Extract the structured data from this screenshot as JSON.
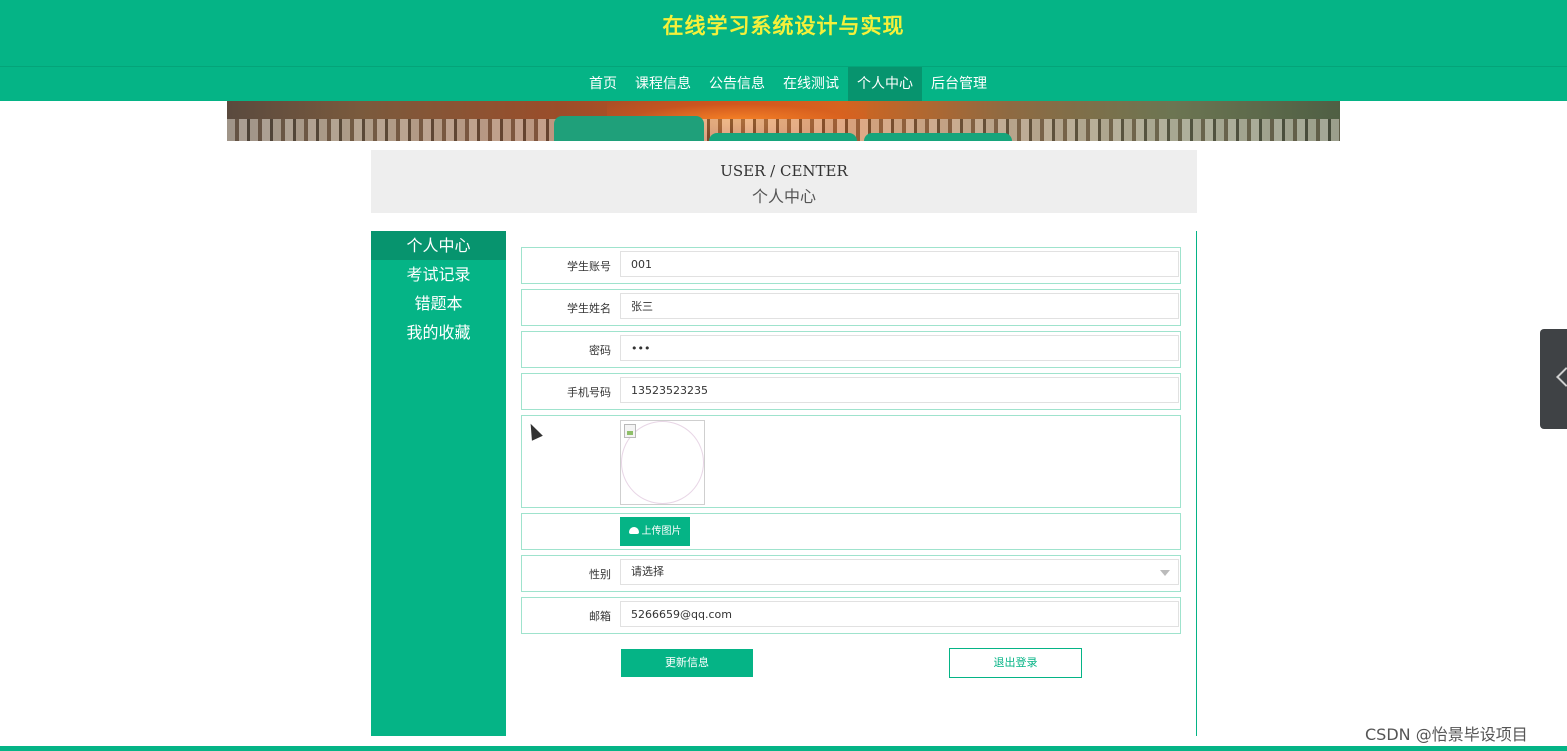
{
  "site": {
    "title": "在线学习系统设计与实现"
  },
  "nav": {
    "items": [
      {
        "label": "首页"
      },
      {
        "label": "课程信息"
      },
      {
        "label": "公告信息"
      },
      {
        "label": "在线测试"
      },
      {
        "label": "个人中心",
        "active": true
      },
      {
        "label": "后台管理"
      }
    ]
  },
  "section": {
    "title_en": "USER / CENTER",
    "title_cn": "个人中心"
  },
  "sidebar": {
    "items": [
      {
        "label": "个人中心",
        "active": true
      },
      {
        "label": "考试记录"
      },
      {
        "label": "错题本"
      },
      {
        "label": "我的收藏"
      }
    ]
  },
  "form": {
    "account": {
      "label": "学生账号",
      "value": "001"
    },
    "name": {
      "label": "学生姓名",
      "value": "张三"
    },
    "password": {
      "label": "密码",
      "value": "•••"
    },
    "phone": {
      "label": "手机号码",
      "value": "13523523235"
    },
    "upload_label": "上传图片",
    "gender": {
      "label": "性别",
      "value": "请选择"
    },
    "email": {
      "label": "邮箱",
      "value": "5266659@qq.com"
    }
  },
  "actions": {
    "update": "更新信息",
    "logout": "退出登录"
  },
  "watermark": "CSDN @怡景毕设项目",
  "colors": {
    "primary": "#05b486",
    "active": "#07946e",
    "title": "#f5f03a"
  }
}
